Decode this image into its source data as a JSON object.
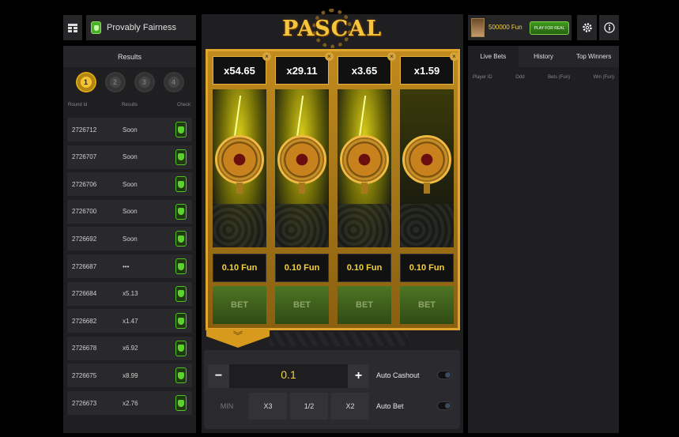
{
  "header": {
    "fairness_label": "Provably Fairness",
    "logo_text": "PASCAL",
    "balance": "500000 Fun",
    "play_real_label": "PLAY FOR REAL"
  },
  "results": {
    "title": "Results",
    "tabs": [
      "1",
      "2",
      "3",
      "4"
    ],
    "col_round": "Round Id",
    "col_results": "Results",
    "col_check": "Check",
    "rows": [
      {
        "round": "2726712",
        "result": "Soon"
      },
      {
        "round": "2726707",
        "result": "Soon"
      },
      {
        "round": "2726706",
        "result": "Soon"
      },
      {
        "round": "2726700",
        "result": "Soon"
      },
      {
        "round": "2726692",
        "result": "Soon"
      },
      {
        "round": "2726687",
        "result": "•••"
      },
      {
        "round": "2726684",
        "result": "x5.13"
      },
      {
        "round": "2726682",
        "result": "x1.47"
      },
      {
        "round": "2726678",
        "result": "x6.92"
      },
      {
        "round": "2726675",
        "result": "x8.99"
      },
      {
        "round": "2726673",
        "result": "x2.76"
      }
    ]
  },
  "reels": [
    {
      "multiplier": "x54.65",
      "stake": "0.10 Fun",
      "bet_label": "BET",
      "glow": true
    },
    {
      "multiplier": "x29.11",
      "stake": "0.10 Fun",
      "bet_label": "BET",
      "glow": true
    },
    {
      "multiplier": "x3.65",
      "stake": "0.10 Fun",
      "bet_label": "BET",
      "glow": true
    },
    {
      "multiplier": "x1.59",
      "stake": "0.10 Fun",
      "bet_label": "BET",
      "glow": false
    }
  ],
  "controls": {
    "minus": "−",
    "plus": "+",
    "amount": "0.1",
    "quick": [
      "MIN",
      "X3",
      "1/2",
      "X2"
    ],
    "auto_cashout": "Auto Cashout",
    "auto_bet": "Auto Bet"
  },
  "bets": {
    "tabs": [
      "Live Bets",
      "History",
      "Top Winners"
    ],
    "cols": [
      "Player ID",
      "Odd",
      "Bets (Fun)",
      "Win (Fun)"
    ]
  },
  "icons": {
    "menu": "menu-icon",
    "settings": "gear-icon",
    "info": "info-icon"
  },
  "colors": {
    "accent_gold": "#f4d23a",
    "frame_gold": "#c08a1e",
    "success_green": "#53c224"
  }
}
